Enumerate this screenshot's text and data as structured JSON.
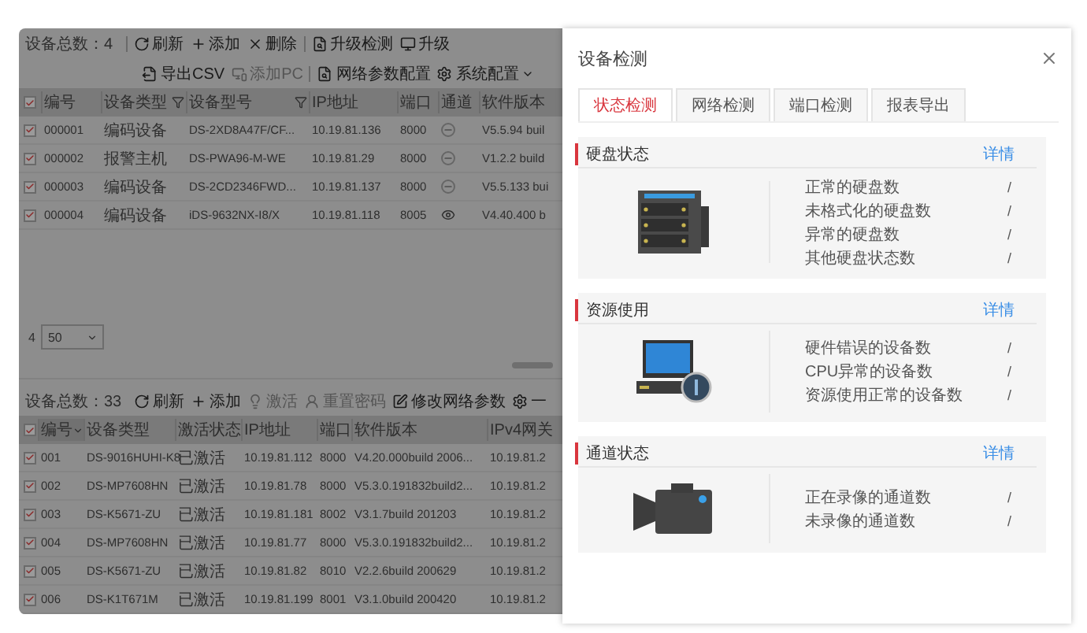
{
  "device_panel": {
    "count_label": "设备总数：4",
    "toolbar": [
      {
        "kind": "refresh",
        "label": "刷新",
        "disabled": false
      },
      {
        "kind": "add",
        "label": "添加",
        "disabled": false
      },
      {
        "kind": "delete",
        "label": "删除",
        "disabled": false
      },
      {
        "kind": "divider"
      },
      {
        "kind": "check",
        "label": "升级检测",
        "disabled": false
      },
      {
        "kind": "monitor",
        "label": "升级",
        "disabled": false
      }
    ],
    "toolbar_row2": [
      {
        "kind": "export",
        "label": "导出CSV",
        "disabled": false
      },
      {
        "kind": "pc",
        "label": "添加PC",
        "disabled": true
      },
      {
        "kind": "divider"
      },
      {
        "kind": "check",
        "label": "网络参数配置",
        "disabled": false
      },
      {
        "kind": "gear",
        "label": "系统配置",
        "disabled": false,
        "dropdown": true
      }
    ],
    "header_checked": true,
    "columns": [
      {
        "label": "编号",
        "filter": false
      },
      {
        "label": "设备类型",
        "filter": true
      },
      {
        "label": "设备型号",
        "filter": true
      },
      {
        "label": "IP地址",
        "filter": false
      },
      {
        "label": "端口",
        "filter": false
      },
      {
        "label": "通道",
        "filter": false
      },
      {
        "label": "软件版本",
        "filter": false
      }
    ],
    "rows": [
      {
        "checked": true,
        "number": "000001",
        "type": "编码设备",
        "model": "DS-2XD8A47F/CF...",
        "ip": "10.19.81.136",
        "port": "8000",
        "kind": "idle",
        "version": "V5.5.94 buil"
      },
      {
        "checked": true,
        "number": "000002",
        "type": "报警主机",
        "model": "DS-PWA96-M-WE",
        "ip": "10.19.81.29",
        "port": "8000",
        "kind": "idle",
        "version": "V1.2.2 build"
      },
      {
        "checked": true,
        "number": "000003",
        "type": "编码设备",
        "model": "DS-2CD2346FWD...",
        "ip": "10.19.81.137",
        "port": "8000",
        "kind": "idle",
        "version": "V5.5.133 bui"
      },
      {
        "checked": true,
        "number": "000004",
        "type": "编码设备",
        "model": "iDS-9632NX-I8/X",
        "ip": "10.19.81.118",
        "port": "8005",
        "kind": "view",
        "version": "V4.40.400 b"
      }
    ],
    "pagination": {
      "total": "4",
      "page_size": "50"
    }
  },
  "online_panel": {
    "count_label": "设备总数：33",
    "toolbar": [
      {
        "kind": "refresh",
        "label": "刷新",
        "disabled": false
      },
      {
        "kind": "add",
        "label": "添加",
        "disabled": false
      },
      {
        "kind": "bulb",
        "label": "激活",
        "disabled": true
      },
      {
        "kind": "user",
        "label": "重置密码",
        "disabled": true
      },
      {
        "kind": "edit",
        "label": "修改网络参数",
        "disabled": false
      },
      {
        "kind": "gear",
        "label": "一",
        "disabled": false
      }
    ],
    "header_checked": true,
    "columns": [
      {
        "label": "编号",
        "sorted": true
      },
      {
        "label": "设备类型"
      },
      {
        "label": "激活状态"
      },
      {
        "label": "IP地址"
      },
      {
        "label": "端口"
      },
      {
        "label": "软件版本"
      },
      {
        "label": "IPv4网关"
      }
    ],
    "rows": [
      {
        "checked": true,
        "cells": [
          "001",
          "DS-9016HUHI-K8",
          "已激活",
          "10.19.81.112",
          "8000",
          "V4.20.000build 2006...",
          "10.19.81.2"
        ]
      },
      {
        "checked": true,
        "cells": [
          "002",
          "DS-MP7608HN",
          "已激活",
          "10.19.81.78",
          "8000",
          "V5.3.0.191832build2...",
          "10.19.81.2"
        ]
      },
      {
        "checked": true,
        "cells": [
          "003",
          "DS-K5671-ZU",
          "已激活",
          "10.19.81.181",
          "8002",
          "V3.1.7build 201203",
          "10.19.81.2"
        ]
      },
      {
        "checked": true,
        "cells": [
          "004",
          "DS-MP7608HN",
          "已激活",
          "10.19.81.77",
          "8000",
          "V5.3.0.191832build2...",
          "10.19.81.2"
        ]
      },
      {
        "checked": true,
        "cells": [
          "005",
          "DS-K5671-ZU",
          "已激活",
          "10.19.81.82",
          "8010",
          "V2.2.6build 200629",
          "10.19.81.2"
        ]
      },
      {
        "checked": true,
        "cells": [
          "006",
          "DS-K1T671M",
          "已激活",
          "10.19.81.199",
          "8001",
          "V3.1.0build 200420",
          "10.19.81.2"
        ]
      }
    ]
  },
  "dialog": {
    "title": "设备检测",
    "tabs": [
      {
        "label": "状态检测",
        "selected": true
      },
      {
        "label": "网络检测",
        "selected": false
      },
      {
        "label": "端口检测",
        "selected": false
      },
      {
        "label": "报表导出",
        "selected": false
      }
    ],
    "sections": [
      {
        "kind": "disk",
        "title": "硬盘状态",
        "link": "详情",
        "items": [
          {
            "label": "正常的硬盘数",
            "value": "/"
          },
          {
            "label": "未格式化的硬盘数",
            "value": "/"
          },
          {
            "label": "异常的硬盘数",
            "value": "/"
          },
          {
            "label": "其他硬盘状态数",
            "value": "/"
          }
        ]
      },
      {
        "kind": "computer",
        "title": "资源使用",
        "link": "详情",
        "items": [
          {
            "label": "硬件错误的设备数",
            "value": "/"
          },
          {
            "label": "CPU异常的设备数",
            "value": "/"
          },
          {
            "label": "资源使用正常的设备数",
            "value": "/"
          }
        ]
      },
      {
        "kind": "camera",
        "title": "通道状态",
        "link": "详情",
        "items": [
          {
            "label": "正在录像的通道数",
            "value": "/"
          },
          {
            "label": "未录像的通道数",
            "value": "/"
          }
        ]
      }
    ]
  }
}
